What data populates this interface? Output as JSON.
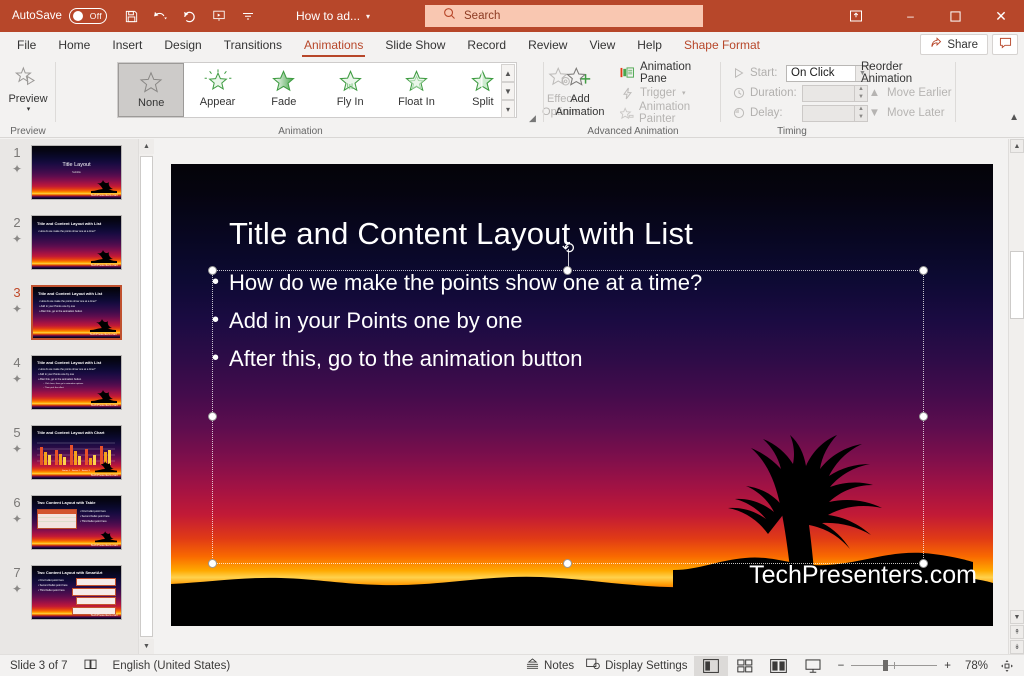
{
  "titlebar": {
    "autosave_label": "AutoSave",
    "autosave_state": "Off",
    "icons": [
      "save-icon",
      "undo-icon",
      "redo-icon",
      "start-slideshow-icon",
      "customize-quick-access-icon"
    ],
    "document_title": "How to ad...",
    "search_placeholder": "Search",
    "ribbon_display_icon": "ribbon-display-options-icon",
    "minimize": "–",
    "maximize": "☐",
    "close": "✕"
  },
  "tabs": [
    {
      "label": "File",
      "state": "normal"
    },
    {
      "label": "Home",
      "state": "normal"
    },
    {
      "label": "Insert",
      "state": "normal"
    },
    {
      "label": "Design",
      "state": "normal"
    },
    {
      "label": "Transitions",
      "state": "normal"
    },
    {
      "label": "Animations",
      "state": "active"
    },
    {
      "label": "Slide Show",
      "state": "normal"
    },
    {
      "label": "Record",
      "state": "normal"
    },
    {
      "label": "Review",
      "state": "normal"
    },
    {
      "label": "View",
      "state": "normal"
    },
    {
      "label": "Help",
      "state": "normal"
    },
    {
      "label": "Shape Format",
      "state": "contextual"
    }
  ],
  "share": {
    "share_label": "Share",
    "comments_icon": "comment-icon"
  },
  "ribbon": {
    "preview": {
      "button_label": "Preview",
      "group_label": "Preview"
    },
    "animation": {
      "group_label": "Animation",
      "gallery": [
        {
          "label": "None",
          "selected": true
        },
        {
          "label": "Appear",
          "selected": false
        },
        {
          "label": "Fade",
          "selected": false
        },
        {
          "label": "Fly In",
          "selected": false
        },
        {
          "label": "Float In",
          "selected": false
        },
        {
          "label": "Split",
          "selected": false
        }
      ],
      "effect_options_line1": "Effect",
      "effect_options_line2": "Options",
      "dialog_launcher": "animation-dialog-launcher"
    },
    "advanced_animation": {
      "group_label": "Advanced Animation",
      "add_animation_line1": "Add",
      "add_animation_line2": "Animation",
      "animation_pane": "Animation Pane",
      "trigger": "Trigger",
      "animation_painter": "Animation Painter"
    },
    "timing": {
      "group_label": "Timing",
      "start_label": "Start:",
      "start_value": "On Click",
      "duration_label": "Duration:",
      "duration_value": "",
      "delay_label": "Delay:",
      "delay_value": "",
      "reorder_label": "Reorder Animation",
      "move_earlier": "Move Earlier",
      "move_later": "Move Later"
    },
    "collapse_icon": "collapse-ribbon-icon"
  },
  "thumbnails": [
    {
      "number": "1",
      "title": "Title Layout",
      "current": false
    },
    {
      "number": "2",
      "title": "Title and Content Layout with List",
      "current": false
    },
    {
      "number": "3",
      "title": "Title and Content Layout with List",
      "current": true
    },
    {
      "number": "4",
      "title": "Title and Content Layout with List",
      "current": false
    },
    {
      "number": "5",
      "title": "Title and Content Layout with Chart",
      "current": false
    },
    {
      "number": "6",
      "title": "Two Content Layout with Table",
      "current": false
    },
    {
      "number": "7",
      "title": "Two Content Layout with SmartArt",
      "current": false
    }
  ],
  "slide": {
    "title": "Title and Content Layout with List",
    "bullets": [
      "How do we make the points show one at a time?",
      "Add in your Points one by one",
      "After this, go to the animation button"
    ],
    "bullet_char": "•",
    "watermark": "TechPresenters.com"
  },
  "statusbar": {
    "slide_counter": "Slide 3 of 7",
    "accessibility_icon": "accessibility-icon",
    "language": "English (United States)",
    "notes_label": "Notes",
    "display_settings_label": "Display Settings",
    "views": [
      {
        "name": "normal-view",
        "selected": true
      },
      {
        "name": "slide-sorter-view",
        "selected": false
      },
      {
        "name": "reading-view",
        "selected": false
      },
      {
        "name": "slide-show-view",
        "selected": false
      }
    ],
    "zoom_out": "−",
    "zoom_in": "+",
    "zoom_level": "78%",
    "fit_icon": "fit-slide-to-window-icon"
  },
  "colors": {
    "accent": "#b7472a",
    "titlebar_bg": "#b7472a",
    "search_bg": "#f9c7b1",
    "ribbon_bg": "#f3f2f1",
    "panel_bg": "#e9e7e5",
    "selection_border": "#c0512f",
    "star_green": "#46a046"
  }
}
